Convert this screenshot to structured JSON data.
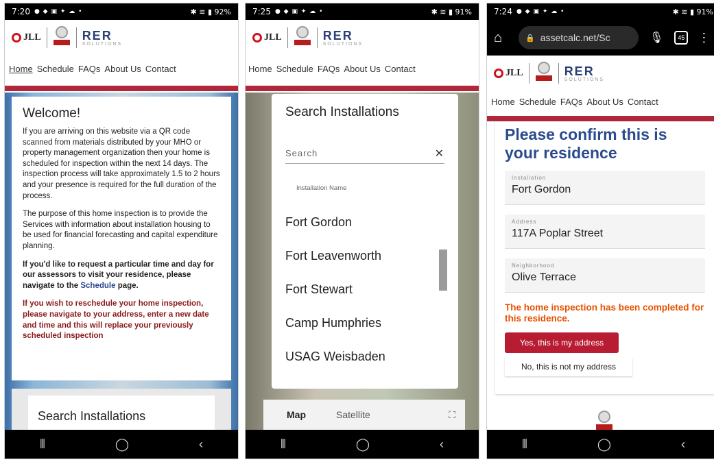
{
  "phones": [
    {
      "status": {
        "time": "7:20",
        "battery": "92%"
      },
      "nav": [
        "Home",
        "Schedule",
        "FAQs",
        "About Us",
        "Contact"
      ],
      "welcome": {
        "title": "Welcome!",
        "p1": "If you are arriving on this website via a QR code scanned from materials distributed by your MHO or property management organization then your home is scheduled for inspection within the next 14 days. The inspection process will take approximately 1.5 to 2 hours and your presence is required for the full duration of the process.",
        "p2": "The purpose of this home inspection is to provide the Services with information about installation housing to be used for financial forecasting and capital expenditure planning.",
        "p3_pre": "If you'd like to request a particular time and day for our assessors to visit your residence, please navigate to the ",
        "p3_link": "Schedule",
        "p3_post": " page.",
        "p4": "If you wish to reschedule your home inspection, please navigate to your address, enter a new date and time and this will replace your previously scheduled inspection"
      },
      "search_title": "Search Installations"
    },
    {
      "status": {
        "time": "7:25",
        "battery": "91%"
      },
      "nav": [
        "Home",
        "Schedule",
        "FAQs",
        "About Us",
        "Contact"
      ],
      "panel": {
        "title": "Search Installations",
        "search_placeholder": "Search",
        "column_header": "Installation Name",
        "installations": [
          "Fort Gordon",
          "Fort Leavenworth",
          "Fort Stewart",
          "Camp Humphries",
          "USAG Weisbaden"
        ]
      },
      "map_toggle": {
        "map": "Map",
        "satellite": "Satellite"
      }
    },
    {
      "status": {
        "time": "7:24",
        "battery": "91%"
      },
      "url": "assetcalc.net/Sc",
      "tab_count": "45",
      "nav": [
        "Home",
        "Schedule",
        "FAQs",
        "About Us",
        "Contact"
      ],
      "confirm": {
        "title": "Please confirm this is your residence",
        "installation_label": "Installation",
        "installation_value": "Fort Gordon",
        "address_label": "Address",
        "address_value": "117A Poplar Street",
        "neighborhood_label": "Neighborhood",
        "neighborhood_value": "Olive Terrace",
        "completed_msg": "The home inspection has been completed for this residence.",
        "yes_label": "Yes, this is my address",
        "no_label": "No, this is not my address"
      }
    }
  ],
  "brand": {
    "jll": "JLL",
    "rer": "RER",
    "rer_sub": "SOLUTIONS"
  },
  "colors": {
    "accent_red": "#b0263a",
    "title_blue": "#2a4b8d",
    "warning_orange": "#e65100"
  }
}
